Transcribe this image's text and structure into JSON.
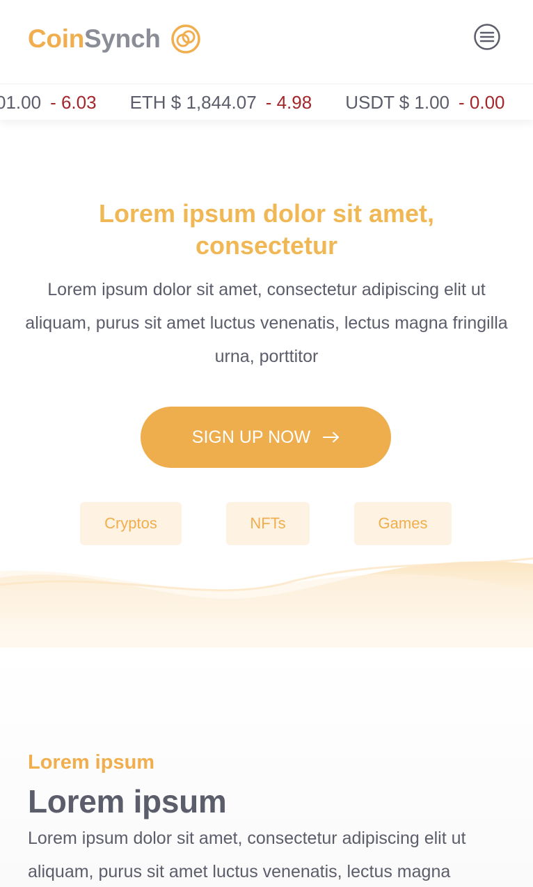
{
  "header": {
    "logo_part1": "Coin",
    "logo_part2": "Synch",
    "logo_icon": "coinsynch-rings-icon",
    "menu_icon": "hamburger-menu-icon"
  },
  "ticker": [
    {
      "price": "01.00",
      "change": "- 6.03"
    },
    {
      "price": "ETH $ 1,844.07",
      "change": "- 4.98"
    },
    {
      "price": "USDT $ 1.00",
      "change": "- 0.00"
    }
  ],
  "hero": {
    "title": "Lorem ipsum dolor sit amet, consectetur",
    "text": "Lorem ipsum dolor sit amet, consectetur adipiscing elit ut aliquam, purus sit amet luctus venenatis, lectus magna fringilla urna, porttitor",
    "cta_label": "SIGN UP NOW",
    "cta_icon": "arrow-right-icon"
  },
  "tags": [
    "Cryptos",
    "NFTs",
    "Games"
  ],
  "section": {
    "kicker": "Lorem ipsum",
    "title": "Lorem ipsum",
    "text": "Lorem ipsum dolor sit amet, consectetur adipiscing elit ut aliquam, purus sit amet luctus venenatis, lectus magna"
  },
  "colors": {
    "brand": "#F0AE4E",
    "text": "#5B5D6B",
    "negative": "#A3262A",
    "tag_bg": "#FEF3E2"
  }
}
